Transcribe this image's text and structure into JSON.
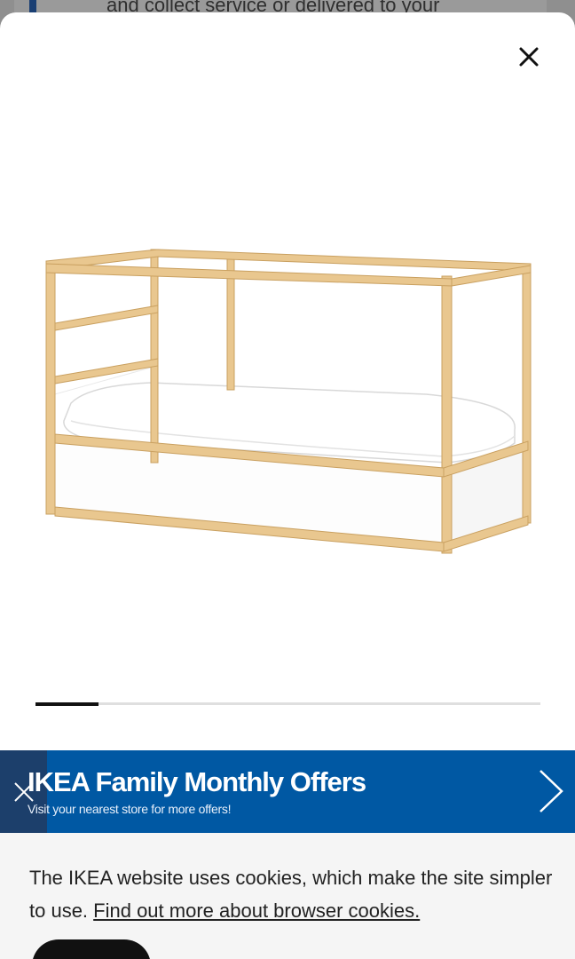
{
  "background": {
    "text": "and collect service or delivered to your"
  },
  "modal": {
    "close_icon": "close-icon",
    "product_image_alt": "KURA reversible bed",
    "carousel": {
      "current": 1,
      "total": 8
    }
  },
  "banner": {
    "title": "IKEA Family Monthly Offers",
    "subtitle": "Visit your nearest store for more offers!",
    "close_icon": "close-icon",
    "arrow_icon": "chevron-right-icon",
    "color": "#0058a3"
  },
  "cookie": {
    "text": "The IKEA website uses cookies, which make the site simpler to use. ",
    "link_text": "Find out more about browser cookies."
  }
}
